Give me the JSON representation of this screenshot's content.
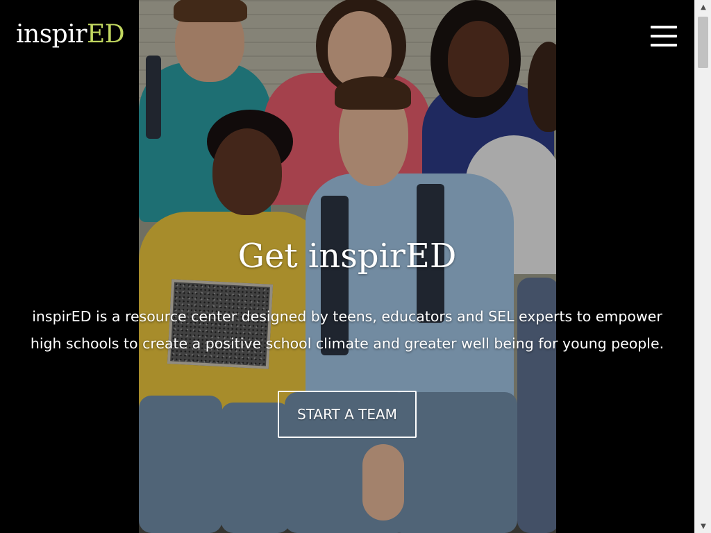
{
  "header": {
    "logo_prefix": "inspir",
    "logo_suffix": "ED",
    "menu_icon": "hamburger-menu-icon"
  },
  "hero": {
    "title": "Get inspirED",
    "description": "inspirED is a resource center designed by teens, educators and SEL experts to empower high schools to create a positive school climate and greater well being for young people.",
    "cta_label": "START A TEAM"
  },
  "scrollbar": {
    "up_icon": "▲",
    "down_icon": "▼"
  },
  "colors": {
    "background": "#000000",
    "logo_accent": "#c2d860",
    "text": "#ffffff"
  }
}
